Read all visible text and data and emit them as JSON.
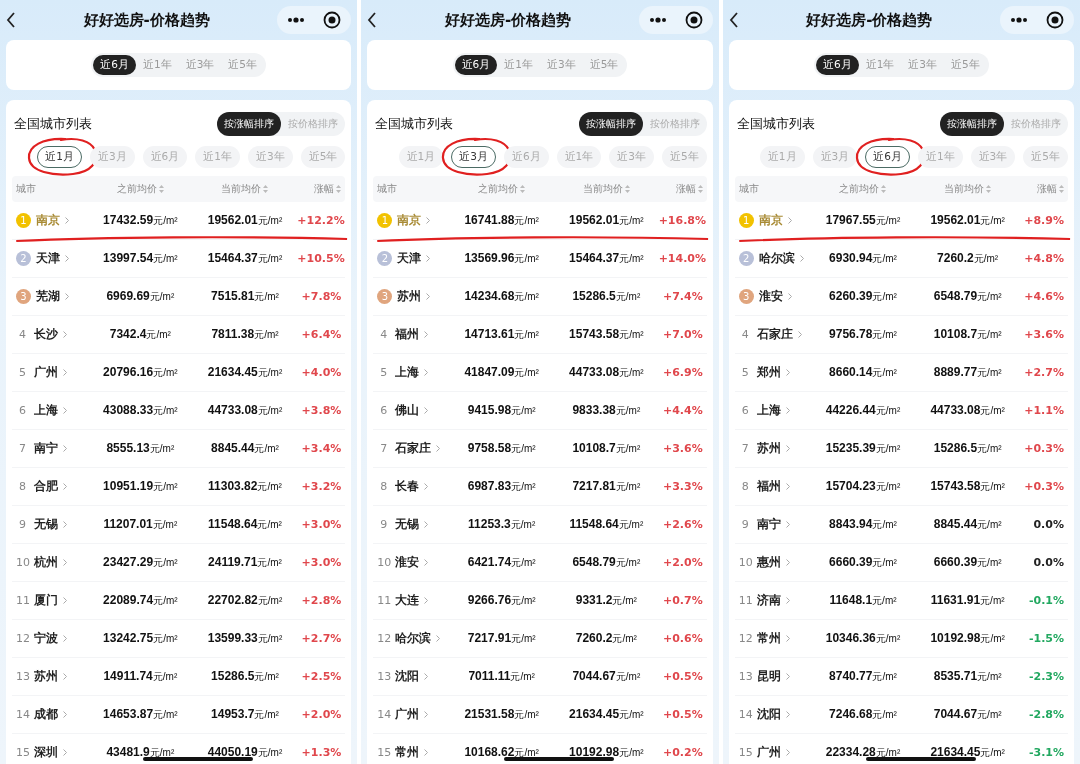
{
  "panels": [
    {
      "title": "好好选房-价格趋势",
      "chart_periods": [
        {
          "label": "近6月",
          "selected": true
        },
        {
          "label": "近1年",
          "selected": false
        },
        {
          "label": "近3年",
          "selected": false
        },
        {
          "label": "近5年",
          "selected": false
        }
      ],
      "list_title": "全国城市列表",
      "sort_options": [
        {
          "label": "按涨幅排序",
          "selected": true
        },
        {
          "label": "按价格排序",
          "selected": false
        }
      ],
      "periods": [
        {
          "label": "近1月",
          "selected": true,
          "circled": true
        },
        {
          "label": "近3月",
          "selected": false,
          "circled": false
        },
        {
          "label": "近6月",
          "selected": false,
          "circled": false
        },
        {
          "label": "近1年",
          "selected": false,
          "circled": false
        },
        {
          "label": "近3年",
          "selected": false,
          "circled": false
        },
        {
          "label": "近5年",
          "selected": false,
          "circled": false
        }
      ],
      "columns": [
        "城市",
        "之前均价",
        "当前均价",
        "涨幅"
      ],
      "rows": [
        {
          "rank": "1",
          "kind": "medal",
          "color": "#f2c200",
          "city": "南京",
          "prev": "17432.59",
          "prev_unit": "元/m²",
          "curr": "19562.01",
          "curr_unit": "元/m²",
          "change": {
            "text": "+12.2%",
            "color": "#e0474c"
          },
          "underlined": true
        },
        {
          "rank": "2",
          "kind": "medal",
          "color": "#b8c0d8",
          "city": "天津",
          "prev": "13997.54",
          "prev_unit": "元/m²",
          "curr": "15464.37",
          "curr_unit": "元/m²",
          "change": {
            "text": "+10.5%",
            "color": "#e0474c"
          },
          "underlined": false
        },
        {
          "rank": "3",
          "kind": "medal",
          "color": "#e0a57e",
          "city": "芜湖",
          "prev": "6969.69",
          "prev_unit": "元/m²",
          "curr": "7515.81",
          "curr_unit": "元/m²",
          "change": {
            "text": "+7.8%",
            "color": "#e0474c"
          },
          "underlined": false
        },
        {
          "rank": "4",
          "kind": "plain",
          "city": "长沙",
          "prev": "7342.4",
          "prev_unit": "元/m²",
          "curr": "7811.38",
          "curr_unit": "元/m²",
          "change": {
            "text": "+6.4%",
            "color": "#e0474c"
          },
          "underlined": false
        },
        {
          "rank": "5",
          "kind": "plain",
          "city": "广州",
          "prev": "20796.16",
          "prev_unit": "元/m²",
          "curr": "21634.45",
          "curr_unit": "元/m²",
          "change": {
            "text": "+4.0%",
            "color": "#e0474c"
          },
          "underlined": false
        },
        {
          "rank": "6",
          "kind": "plain",
          "city": "上海",
          "prev": "43088.33",
          "prev_unit": "元/m²",
          "curr": "44733.08",
          "curr_unit": "元/m²",
          "change": {
            "text": "+3.8%",
            "color": "#e0474c"
          },
          "underlined": false
        },
        {
          "rank": "7",
          "kind": "plain",
          "city": "南宁",
          "prev": "8555.13",
          "prev_unit": "元/m²",
          "curr": "8845.44",
          "curr_unit": "元/m²",
          "change": {
            "text": "+3.4%",
            "color": "#e0474c"
          },
          "underlined": false
        },
        {
          "rank": "8",
          "kind": "plain",
          "city": "合肥",
          "prev": "10951.19",
          "prev_unit": "元/m²",
          "curr": "11303.82",
          "curr_unit": "元/m²",
          "change": {
            "text": "+3.2%",
            "color": "#e0474c"
          },
          "underlined": false
        },
        {
          "rank": "9",
          "kind": "plain",
          "city": "无锡",
          "prev": "11207.01",
          "prev_unit": "元/m²",
          "curr": "11548.64",
          "curr_unit": "元/m²",
          "change": {
            "text": "+3.0%",
            "color": "#e0474c"
          },
          "underlined": false
        },
        {
          "rank": "10",
          "kind": "plain",
          "city": "杭州",
          "prev": "23427.29",
          "prev_unit": "元/m²",
          "curr": "24119.71",
          "curr_unit": "元/m²",
          "change": {
            "text": "+3.0%",
            "color": "#e0474c"
          },
          "underlined": false
        },
        {
          "rank": "11",
          "kind": "plain",
          "city": "厦门",
          "prev": "22089.74",
          "prev_unit": "元/m²",
          "curr": "22702.82",
          "curr_unit": "元/m²",
          "change": {
            "text": "+2.8%",
            "color": "#e0474c"
          },
          "underlined": false
        },
        {
          "rank": "12",
          "kind": "plain",
          "city": "宁波",
          "prev": "13242.75",
          "prev_unit": "元/m²",
          "curr": "13599.33",
          "curr_unit": "元/m²",
          "change": {
            "text": "+2.7%",
            "color": "#e0474c"
          },
          "underlined": false
        },
        {
          "rank": "13",
          "kind": "plain",
          "city": "苏州",
          "prev": "14911.74",
          "prev_unit": "元/m²",
          "curr": "15286.5",
          "curr_unit": "元/m²",
          "change": {
            "text": "+2.5%",
            "color": "#e0474c"
          },
          "underlined": false
        },
        {
          "rank": "14",
          "kind": "plain",
          "city": "成都",
          "prev": "14653.87",
          "prev_unit": "元/m²",
          "curr": "14953.7",
          "curr_unit": "元/m²",
          "change": {
            "text": "+2.0%",
            "color": "#e0474c"
          },
          "underlined": false
        },
        {
          "rank": "15",
          "kind": "plain",
          "city": "深圳",
          "prev": "43481.9",
          "prev_unit": "元/m²",
          "curr": "44050.19",
          "curr_unit": "元/m²",
          "change": {
            "text": "+1.3%",
            "color": "#e0474c"
          },
          "underlined": false
        }
      ]
    },
    {
      "title": "好好选房-价格趋势",
      "chart_periods": [
        {
          "label": "近6月",
          "selected": true
        },
        {
          "label": "近1年",
          "selected": false
        },
        {
          "label": "近3年",
          "selected": false
        },
        {
          "label": "近5年",
          "selected": false
        }
      ],
      "list_title": "全国城市列表",
      "sort_options": [
        {
          "label": "按涨幅排序",
          "selected": true
        },
        {
          "label": "按价格排序",
          "selected": false
        }
      ],
      "periods": [
        {
          "label": "近1月",
          "selected": false,
          "circled": false
        },
        {
          "label": "近3月",
          "selected": true,
          "circled": true
        },
        {
          "label": "近6月",
          "selected": false,
          "circled": false
        },
        {
          "label": "近1年",
          "selected": false,
          "circled": false
        },
        {
          "label": "近3年",
          "selected": false,
          "circled": false
        },
        {
          "label": "近5年",
          "selected": false,
          "circled": false
        }
      ],
      "columns": [
        "城市",
        "之前均价",
        "当前均价",
        "涨幅"
      ],
      "rows": [
        {
          "rank": "1",
          "kind": "medal",
          "color": "#f2c200",
          "city": "南京",
          "prev": "16741.88",
          "prev_unit": "元/m²",
          "curr": "19562.01",
          "curr_unit": "元/m²",
          "change": {
            "text": "+16.8%",
            "color": "#e0474c"
          },
          "underlined": true
        },
        {
          "rank": "2",
          "kind": "medal",
          "color": "#b8c0d8",
          "city": "天津",
          "prev": "13569.96",
          "prev_unit": "元/m²",
          "curr": "15464.37",
          "curr_unit": "元/m²",
          "change": {
            "text": "+14.0%",
            "color": "#e0474c"
          },
          "underlined": false
        },
        {
          "rank": "3",
          "kind": "medal",
          "color": "#e0a57e",
          "city": "苏州",
          "prev": "14234.68",
          "prev_unit": "元/m²",
          "curr": "15286.5",
          "curr_unit": "元/m²",
          "change": {
            "text": "+7.4%",
            "color": "#e0474c"
          },
          "underlined": false
        },
        {
          "rank": "4",
          "kind": "plain",
          "city": "福州",
          "prev": "14713.61",
          "prev_unit": "元/m²",
          "curr": "15743.58",
          "curr_unit": "元/m²",
          "change": {
            "text": "+7.0%",
            "color": "#e0474c"
          },
          "underlined": false
        },
        {
          "rank": "5",
          "kind": "plain",
          "city": "上海",
          "prev": "41847.09",
          "prev_unit": "元/m²",
          "curr": "44733.08",
          "curr_unit": "元/m²",
          "change": {
            "text": "+6.9%",
            "color": "#e0474c"
          },
          "underlined": false
        },
        {
          "rank": "6",
          "kind": "plain",
          "city": "佛山",
          "prev": "9415.98",
          "prev_unit": "元/m²",
          "curr": "9833.38",
          "curr_unit": "元/m²",
          "change": {
            "text": "+4.4%",
            "color": "#e0474c"
          },
          "underlined": false
        },
        {
          "rank": "7",
          "kind": "plain",
          "city": "石家庄",
          "prev": "9758.58",
          "prev_unit": "元/m²",
          "curr": "10108.7",
          "curr_unit": "元/m²",
          "change": {
            "text": "+3.6%",
            "color": "#e0474c"
          },
          "underlined": false
        },
        {
          "rank": "8",
          "kind": "plain",
          "city": "长春",
          "prev": "6987.83",
          "prev_unit": "元/m²",
          "curr": "7217.81",
          "curr_unit": "元/m²",
          "change": {
            "text": "+3.3%",
            "color": "#e0474c"
          },
          "underlined": false
        },
        {
          "rank": "9",
          "kind": "plain",
          "city": "无锡",
          "prev": "11253.3",
          "prev_unit": "元/m²",
          "curr": "11548.64",
          "curr_unit": "元/m²",
          "change": {
            "text": "+2.6%",
            "color": "#e0474c"
          },
          "underlined": false
        },
        {
          "rank": "10",
          "kind": "plain",
          "city": "淮安",
          "prev": "6421.74",
          "prev_unit": "元/m²",
          "curr": "6548.79",
          "curr_unit": "元/m²",
          "change": {
            "text": "+2.0%",
            "color": "#e0474c"
          },
          "underlined": false
        },
        {
          "rank": "11",
          "kind": "plain",
          "city": "大连",
          "prev": "9266.76",
          "prev_unit": "元/m²",
          "curr": "9331.2",
          "curr_unit": "元/m²",
          "change": {
            "text": "+0.7%",
            "color": "#e0474c"
          },
          "underlined": false
        },
        {
          "rank": "12",
          "kind": "plain",
          "city": "哈尔滨",
          "prev": "7217.91",
          "prev_unit": "元/m²",
          "curr": "7260.2",
          "curr_unit": "元/m²",
          "change": {
            "text": "+0.6%",
            "color": "#e0474c"
          },
          "underlined": false
        },
        {
          "rank": "13",
          "kind": "plain",
          "city": "沈阳",
          "prev": "7011.11",
          "prev_unit": "元/m²",
          "curr": "7044.67",
          "curr_unit": "元/m²",
          "change": {
            "text": "+0.5%",
            "color": "#e0474c"
          },
          "underlined": false
        },
        {
          "rank": "14",
          "kind": "plain",
          "city": "广州",
          "prev": "21531.58",
          "prev_unit": "元/m²",
          "curr": "21634.45",
          "curr_unit": "元/m²",
          "change": {
            "text": "+0.5%",
            "color": "#e0474c"
          },
          "underlined": false
        },
        {
          "rank": "15",
          "kind": "plain",
          "city": "常州",
          "prev": "10168.62",
          "prev_unit": "元/m²",
          "curr": "10192.98",
          "curr_unit": "元/m²",
          "change": {
            "text": "+0.2%",
            "color": "#e0474c"
          },
          "underlined": false
        }
      ]
    },
    {
      "title": "好好选房-价格趋势",
      "chart_periods": [
        {
          "label": "近6月",
          "selected": true
        },
        {
          "label": "近1年",
          "selected": false
        },
        {
          "label": "近3年",
          "selected": false
        },
        {
          "label": "近5年",
          "selected": false
        }
      ],
      "list_title": "全国城市列表",
      "sort_options": [
        {
          "label": "按涨幅排序",
          "selected": true
        },
        {
          "label": "按价格排序",
          "selected": false
        }
      ],
      "periods": [
        {
          "label": "近1月",
          "selected": false,
          "circled": false
        },
        {
          "label": "近3月",
          "selected": false,
          "circled": false
        },
        {
          "label": "近6月",
          "selected": true,
          "circled": true
        },
        {
          "label": "近1年",
          "selected": false,
          "circled": false
        },
        {
          "label": "近3年",
          "selected": false,
          "circled": false
        },
        {
          "label": "近5年",
          "selected": false,
          "circled": false
        }
      ],
      "columns": [
        "城市",
        "之前均价",
        "当前均价",
        "涨幅"
      ],
      "rows": [
        {
          "rank": "1",
          "kind": "medal",
          "color": "#f2c200",
          "city": "南京",
          "prev": "17967.55",
          "prev_unit": "元/m²",
          "curr": "19562.01",
          "curr_unit": "元/m²",
          "change": {
            "text": "+8.9%",
            "color": "#e0474c"
          },
          "underlined": true
        },
        {
          "rank": "2",
          "kind": "medal",
          "color": "#b8c0d8",
          "city": "哈尔滨",
          "prev": "6930.94",
          "prev_unit": "元/m²",
          "curr": "7260.2",
          "curr_unit": "元/m²",
          "change": {
            "text": "+4.8%",
            "color": "#e0474c"
          },
          "underlined": false
        },
        {
          "rank": "3",
          "kind": "medal",
          "color": "#e0a57e",
          "city": "淮安",
          "prev": "6260.39",
          "prev_unit": "元/m²",
          "curr": "6548.79",
          "curr_unit": "元/m²",
          "change": {
            "text": "+4.6%",
            "color": "#e0474c"
          },
          "underlined": false
        },
        {
          "rank": "4",
          "kind": "plain",
          "city": "石家庄",
          "prev": "9756.78",
          "prev_unit": "元/m²",
          "curr": "10108.7",
          "curr_unit": "元/m²",
          "change": {
            "text": "+3.6%",
            "color": "#e0474c"
          },
          "underlined": false
        },
        {
          "rank": "5",
          "kind": "plain",
          "city": "郑州",
          "prev": "8660.14",
          "prev_unit": "元/m²",
          "curr": "8889.77",
          "curr_unit": "元/m²",
          "change": {
            "text": "+2.7%",
            "color": "#e0474c"
          },
          "underlined": false
        },
        {
          "rank": "6",
          "kind": "plain",
          "city": "上海",
          "prev": "44226.44",
          "prev_unit": "元/m²",
          "curr": "44733.08",
          "curr_unit": "元/m²",
          "change": {
            "text": "+1.1%",
            "color": "#e0474c"
          },
          "underlined": false
        },
        {
          "rank": "7",
          "kind": "plain",
          "city": "苏州",
          "prev": "15235.39",
          "prev_unit": "元/m²",
          "curr": "15286.5",
          "curr_unit": "元/m²",
          "change": {
            "text": "+0.3%",
            "color": "#e0474c"
          },
          "underlined": false
        },
        {
          "rank": "8",
          "kind": "plain",
          "city": "福州",
          "prev": "15704.23",
          "prev_unit": "元/m²",
          "curr": "15743.58",
          "curr_unit": "元/m²",
          "change": {
            "text": "+0.3%",
            "color": "#e0474c"
          },
          "underlined": false
        },
        {
          "rank": "9",
          "kind": "plain",
          "city": "南宁",
          "prev": "8843.94",
          "prev_unit": "元/m²",
          "curr": "8845.44",
          "curr_unit": "元/m²",
          "change": {
            "text": "0.0%",
            "color": "#222222"
          },
          "underlined": false
        },
        {
          "rank": "10",
          "kind": "plain",
          "city": "惠州",
          "prev": "6660.39",
          "prev_unit": "元/m²",
          "curr": "6660.39",
          "curr_unit": "元/m²",
          "change": {
            "text": "0.0%",
            "color": "#222222"
          },
          "underlined": false
        },
        {
          "rank": "11",
          "kind": "plain",
          "city": "济南",
          "prev": "11648.1",
          "prev_unit": "元/m²",
          "curr": "11631.91",
          "curr_unit": "元/m²",
          "change": {
            "text": "-0.1%",
            "color": "#22a860"
          },
          "underlined": false
        },
        {
          "rank": "12",
          "kind": "plain",
          "city": "常州",
          "prev": "10346.36",
          "prev_unit": "元/m²",
          "curr": "10192.98",
          "curr_unit": "元/m²",
          "change": {
            "text": "-1.5%",
            "color": "#22a860"
          },
          "underlined": false
        },
        {
          "rank": "13",
          "kind": "plain",
          "city": "昆明",
          "prev": "8740.77",
          "prev_unit": "元/m²",
          "curr": "8535.71",
          "curr_unit": "元/m²",
          "change": {
            "text": "-2.3%",
            "color": "#22a860"
          },
          "underlined": false
        },
        {
          "rank": "14",
          "kind": "plain",
          "city": "沈阳",
          "prev": "7246.68",
          "prev_unit": "元/m²",
          "curr": "7044.67",
          "curr_unit": "元/m²",
          "change": {
            "text": "-2.8%",
            "color": "#22a860"
          },
          "underlined": false
        },
        {
          "rank": "15",
          "kind": "plain",
          "city": "广州",
          "prev": "22334.28",
          "prev_unit": "元/m²",
          "curr": "21634.45",
          "curr_unit": "元/m²",
          "change": {
            "text": "-3.1%",
            "color": "#22a860"
          },
          "underlined": false
        }
      ]
    }
  ]
}
